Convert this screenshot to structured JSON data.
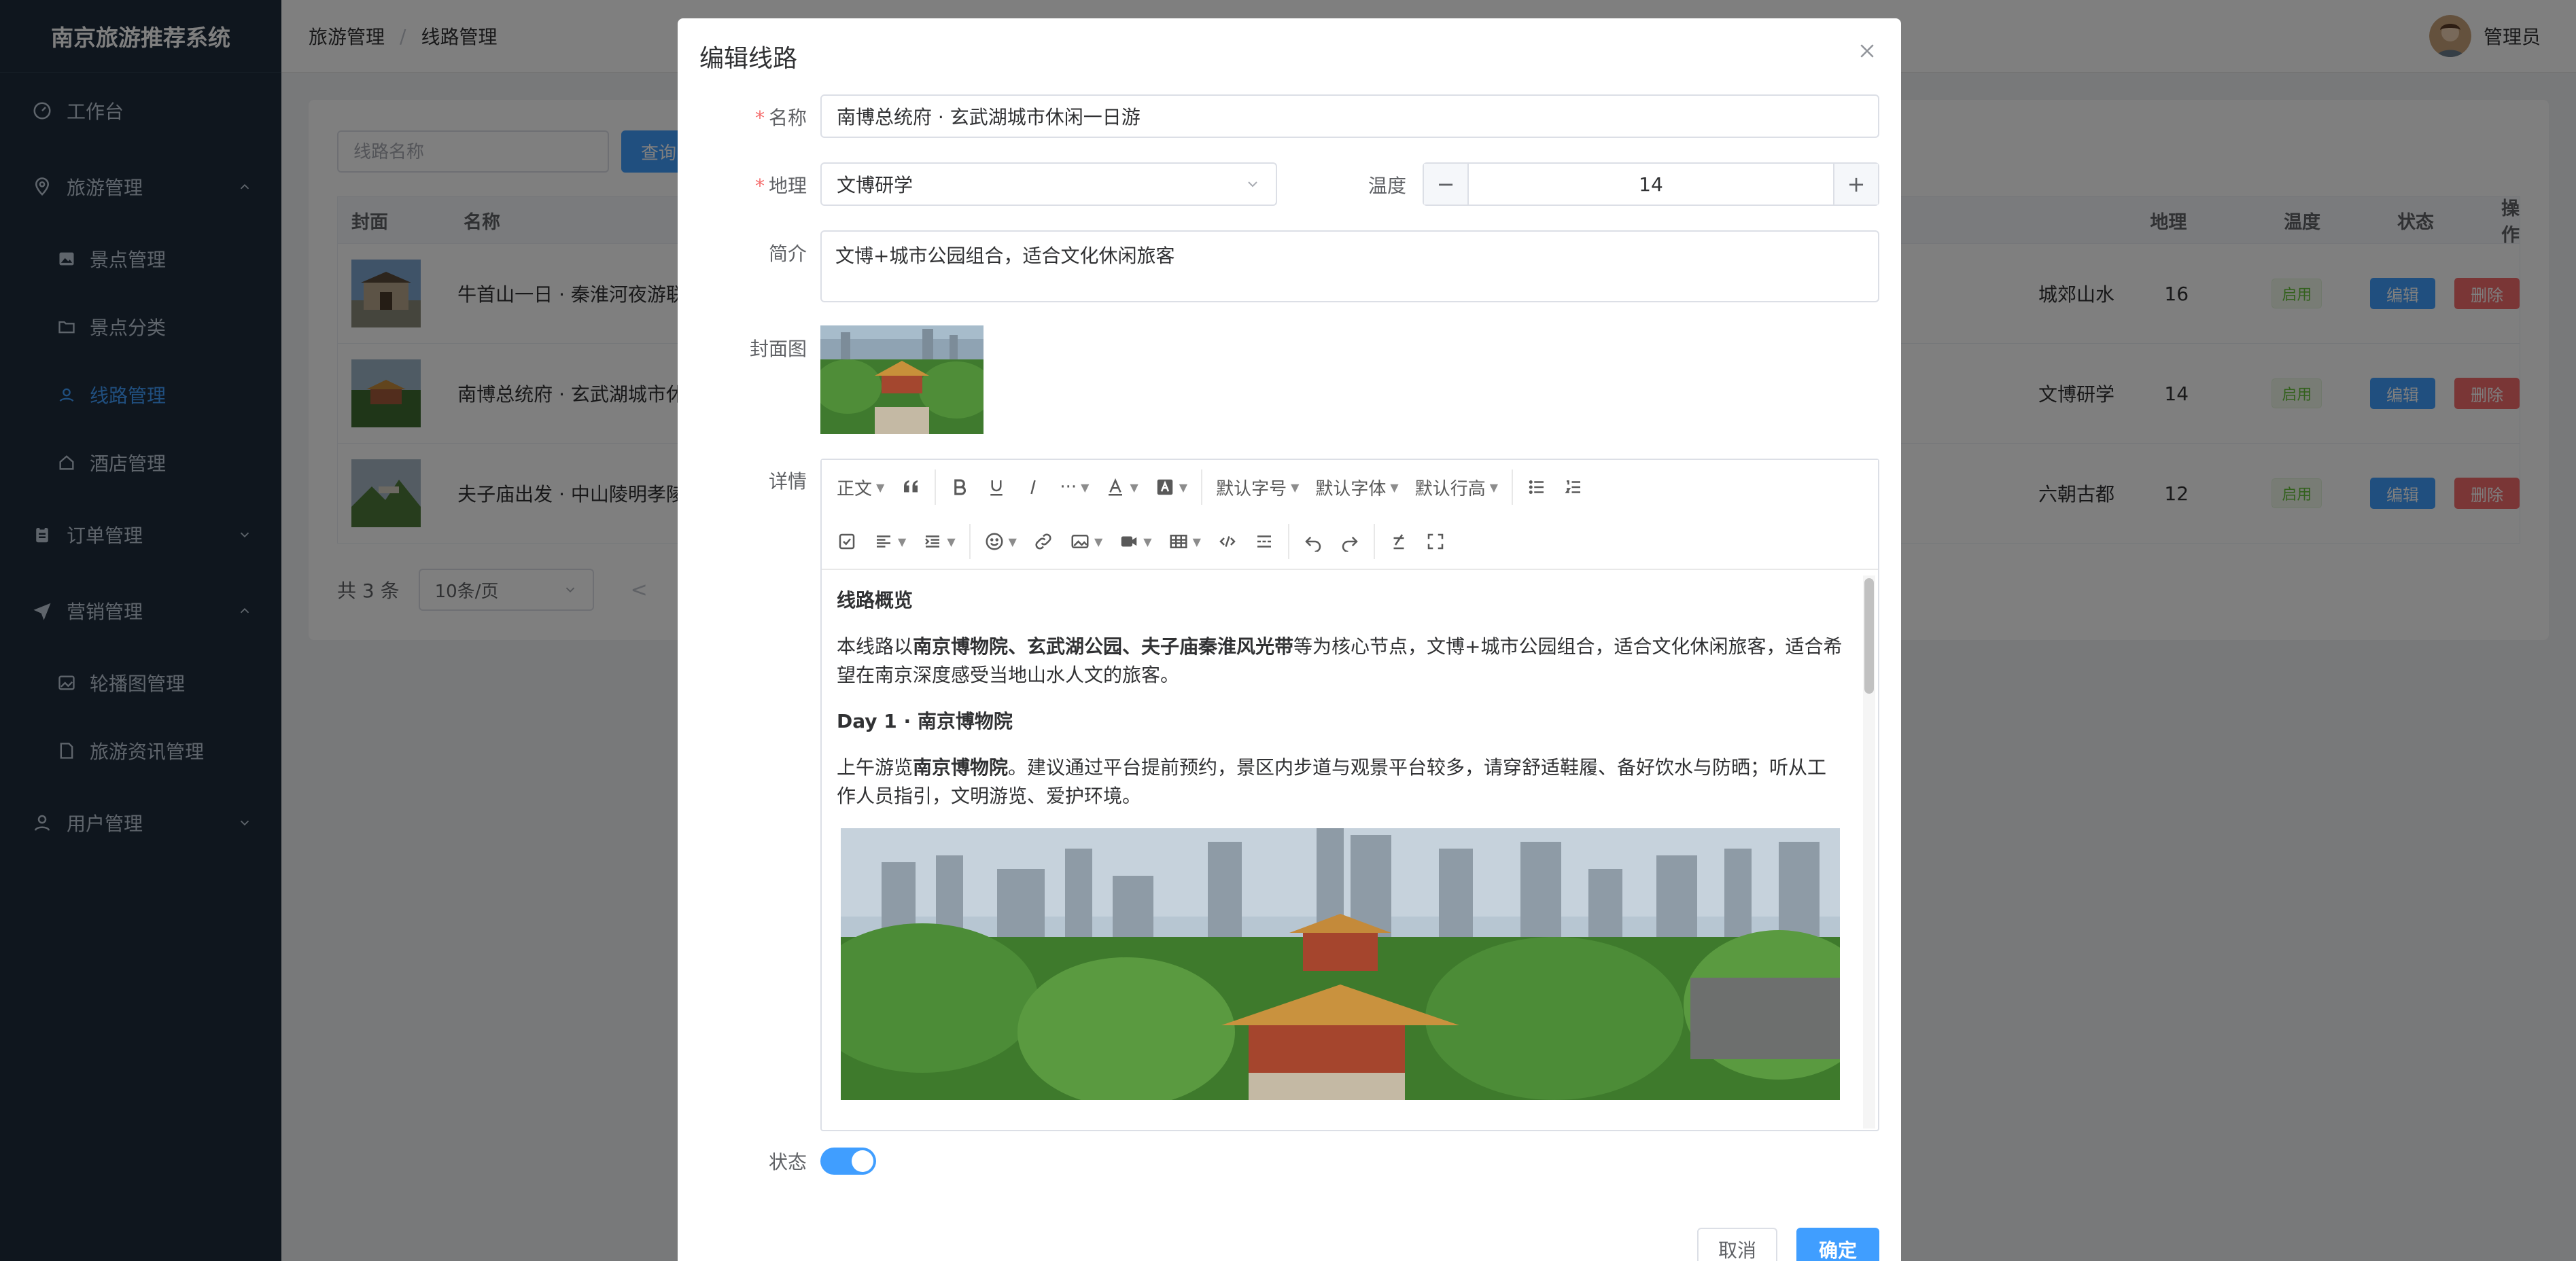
{
  "app": {
    "title": "南京旅游推荐系统"
  },
  "sidebar": {
    "items": [
      {
        "label": "工作台",
        "icon": "dashboard-icon"
      },
      {
        "label": "旅游管理",
        "icon": "location-icon"
      },
      {
        "label": "订单管理",
        "icon": "clipboard-icon"
      },
      {
        "label": "营销管理",
        "icon": "paper-plane-icon"
      },
      {
        "label": "用户管理",
        "icon": "user-icon"
      }
    ],
    "travel_children": [
      {
        "label": "景点管理",
        "icon": "image-icon"
      },
      {
        "label": "景点分类",
        "icon": "folder-icon"
      },
      {
        "label": "线路管理",
        "icon": "route-icon"
      },
      {
        "label": "酒店管理",
        "icon": "house-icon"
      }
    ],
    "marketing_children": [
      {
        "label": "轮播图管理",
        "icon": "picture-icon"
      },
      {
        "label": "旅游资讯管理",
        "icon": "document-icon"
      }
    ]
  },
  "header": {
    "breadcrumb": [
      "旅游管理",
      "线路管理"
    ],
    "separator": "/",
    "user": "管理员"
  },
  "list": {
    "search_placeholder": "线路名称",
    "query_label": "查询",
    "columns": [
      "封面",
      "名称",
      "地理",
      "温度",
      "状态",
      "操作"
    ],
    "rows": [
      {
        "name": "牛首山一日 · 秦淮河夜游联",
        "geo": "城郊山水",
        "temp": "16",
        "status": "启用"
      },
      {
        "name": "南博总统府 · 玄武湖城市休",
        "geo": "文博研学",
        "temp": "14",
        "status": "启用"
      },
      {
        "name": "夫子庙出发 · 中山陵明孝陵",
        "geo": "六朝古都",
        "temp": "12",
        "status": "启用"
      }
    ],
    "edit_label": "编辑",
    "delete_label": "删除",
    "total": "共 3 条",
    "page_size": "10条/页",
    "prev": "<"
  },
  "dialog": {
    "title": "编辑线路",
    "name_label": "名称",
    "name_value": "南博总统府 · 玄武湖城市休闲一日游",
    "geo_label": "地理",
    "geo_value": "文博研学",
    "temp_label": "温度",
    "temp_value": "14",
    "minus": "−",
    "plus": "+",
    "intro_label": "简介",
    "intro_value": "文博+城市公园组合，适合文化休闲旅客",
    "cover_label": "封面图",
    "detail_label": "详情",
    "status_label": "状态",
    "status_on": true,
    "cancel_label": "取消",
    "ok_label": "确定"
  },
  "editor": {
    "toolbar": {
      "paragraph": "正文",
      "font_size": "默认字号",
      "font_family": "默认字体",
      "line_height": "默认行高",
      "more": "···"
    },
    "content": {
      "h1": "线路概览",
      "p1_a": "本线路以",
      "p1_b": "南京博物院、玄武湖公园、夫子庙秦淮风光带",
      "p1_c": "等为核心节点，文博+城市公园组合，适合文化休闲旅客，适合希望在南京深度感受当地山水人文的旅客。",
      "h2": "Day 1 · 南京博物院",
      "p2_a": "上午游览",
      "p2_b": "南京博物院",
      "p2_c": "。建议通过平台提前预约，景区内步道与观景平台较多，请穿舒适鞋履、备好饮水与防晒；听从工作人员指引，文明游览、爱护环境。"
    }
  },
  "colors": {
    "primary": "#409eff",
    "danger": "#f56c6c",
    "success": "#67c23a",
    "sidebar_bg": "#1f2d3d"
  }
}
